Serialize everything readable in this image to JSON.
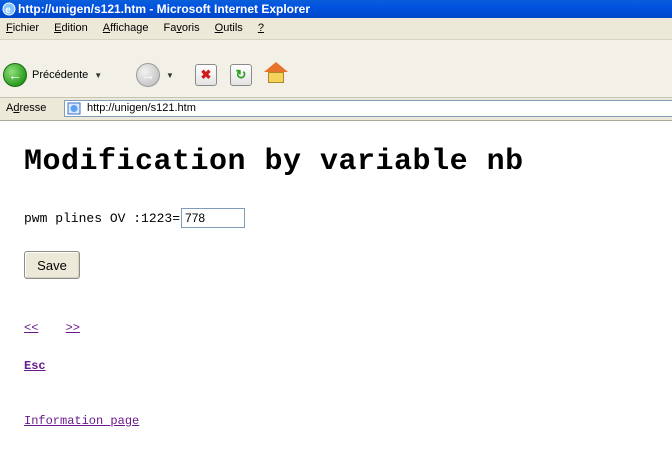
{
  "window": {
    "title": "http://unigen/s121.htm - Microsoft Internet Explorer"
  },
  "menu": {
    "items": [
      "Fichier",
      "Edition",
      "Affichage",
      "Favoris",
      "Outils",
      "?"
    ]
  },
  "toolbar": {
    "back_label": "Précédente"
  },
  "address": {
    "label": "Adresse",
    "url": "http://unigen/s121.htm"
  },
  "page": {
    "heading": "Modification by variable nb",
    "field_label": "pwm plines OV :1223=",
    "field_value": "778",
    "save_label": "Save",
    "prev_link": "<<",
    "next_link": ">>",
    "esc_link": "Esc",
    "info_link": "Information page"
  },
  "colors": {
    "link": "#6a1a8a",
    "titlebar": "#0054e3"
  }
}
